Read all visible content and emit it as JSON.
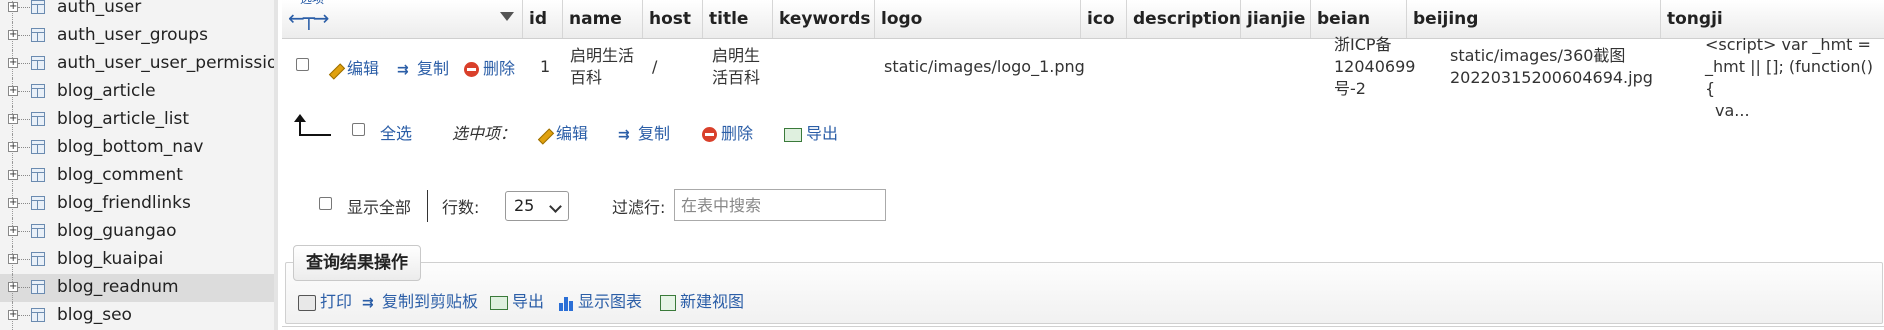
{
  "sidebar": {
    "items": [
      {
        "label": "auth_user"
      },
      {
        "label": "auth_user_groups"
      },
      {
        "label": "auth_user_user_permissions"
      },
      {
        "label": "blog_article"
      },
      {
        "label": "blog_article_list"
      },
      {
        "label": "blog_bottom_nav"
      },
      {
        "label": "blog_comment"
      },
      {
        "label": "blog_friendlinks"
      },
      {
        "label": "blog_guangao"
      },
      {
        "label": "blog_kuaipai"
      },
      {
        "label": "blog_readnum"
      },
      {
        "label": "blog_seo"
      }
    ],
    "highlighted_item": "blog_readnum"
  },
  "table": {
    "option_link": "选项",
    "columns": [
      "id",
      "name",
      "host",
      "title",
      "keywords",
      "logo",
      "ico",
      "description",
      "jianjie",
      "beian",
      "beijing",
      "tongji"
    ],
    "row": {
      "actions": {
        "edit": "编辑",
        "copy": "复制",
        "delete": "删除"
      },
      "id": "1",
      "name_l1": "启明生活",
      "name_l2": "百科",
      "host": "/",
      "title_l1": "启明生",
      "title_l2": "活百科",
      "keywords": "",
      "logo": "static/images/logo_1.png",
      "ico": "",
      "description": "",
      "jianjie": "",
      "beian_l1": "浙ICP备",
      "beian_l2": "12040699",
      "beian_l3": "号-2",
      "beijing_l1": "static/images/360截图",
      "beijing_l2": "20220315200604694.jpg",
      "tongji_l1": "<script> var _hmt =",
      "tongji_l2": "_hmt || []; (function() {",
      "tongji_l3": "va..."
    }
  },
  "bulk": {
    "select_all": "全选",
    "with_selected": "选中项：",
    "edit": "编辑",
    "copy": "复制",
    "delete": "删除",
    "export": "导出"
  },
  "nav": {
    "show_all": "显示全部",
    "rows_label": "行数:",
    "rows_value": "25",
    "filter_label": "过滤行:",
    "filter_placeholder": "在表中搜索"
  },
  "query_ops": {
    "legend": "查询结果操作",
    "print": "打印",
    "copy_clipboard": "复制到剪贴板",
    "export": "导出",
    "show_chart": "显示图表",
    "create_view": "新建视图"
  },
  "colors": {
    "link": "#2b5ea7",
    "header_bg": "#ececec",
    "sidebar_bg": "#f3f3f3"
  }
}
